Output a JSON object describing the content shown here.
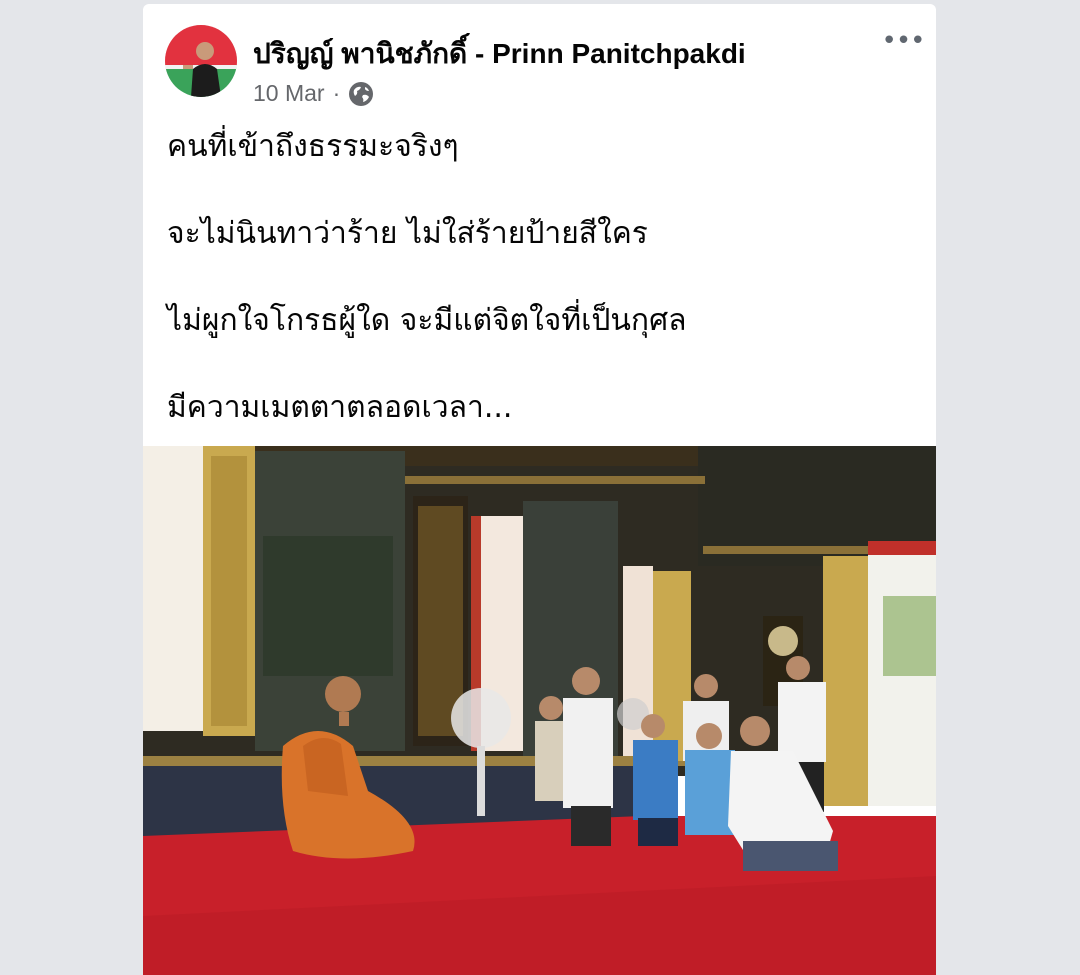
{
  "post": {
    "author": "ปริญญ์ พานิชภักดิ์ - Prinn Panitchpakdi",
    "date": "10 Mar",
    "separator": "·",
    "privacy_icon": "globe-icon",
    "more_icon": "ellipsis-icon",
    "more_label": "•••",
    "paragraphs": [
      "คนที่เข้าถึงธรรมะจริงๆ",
      "จะไม่นินทาว่าร้าย  ไม่ใส่ร้ายป้ายสีใคร",
      "ไม่ผูกใจโกรธผู้ใด  จะมีแต่จิตใจที่เป็นกุศล",
      "มีความเมตตาตลอดเวลา..."
    ]
  },
  "colors": {
    "page_bg": "#e4e6ea",
    "card_bg": "#ffffff",
    "text": "#050505",
    "secondary": "#65676b",
    "carpet": "#c8202a",
    "robe": "#d9732a"
  }
}
